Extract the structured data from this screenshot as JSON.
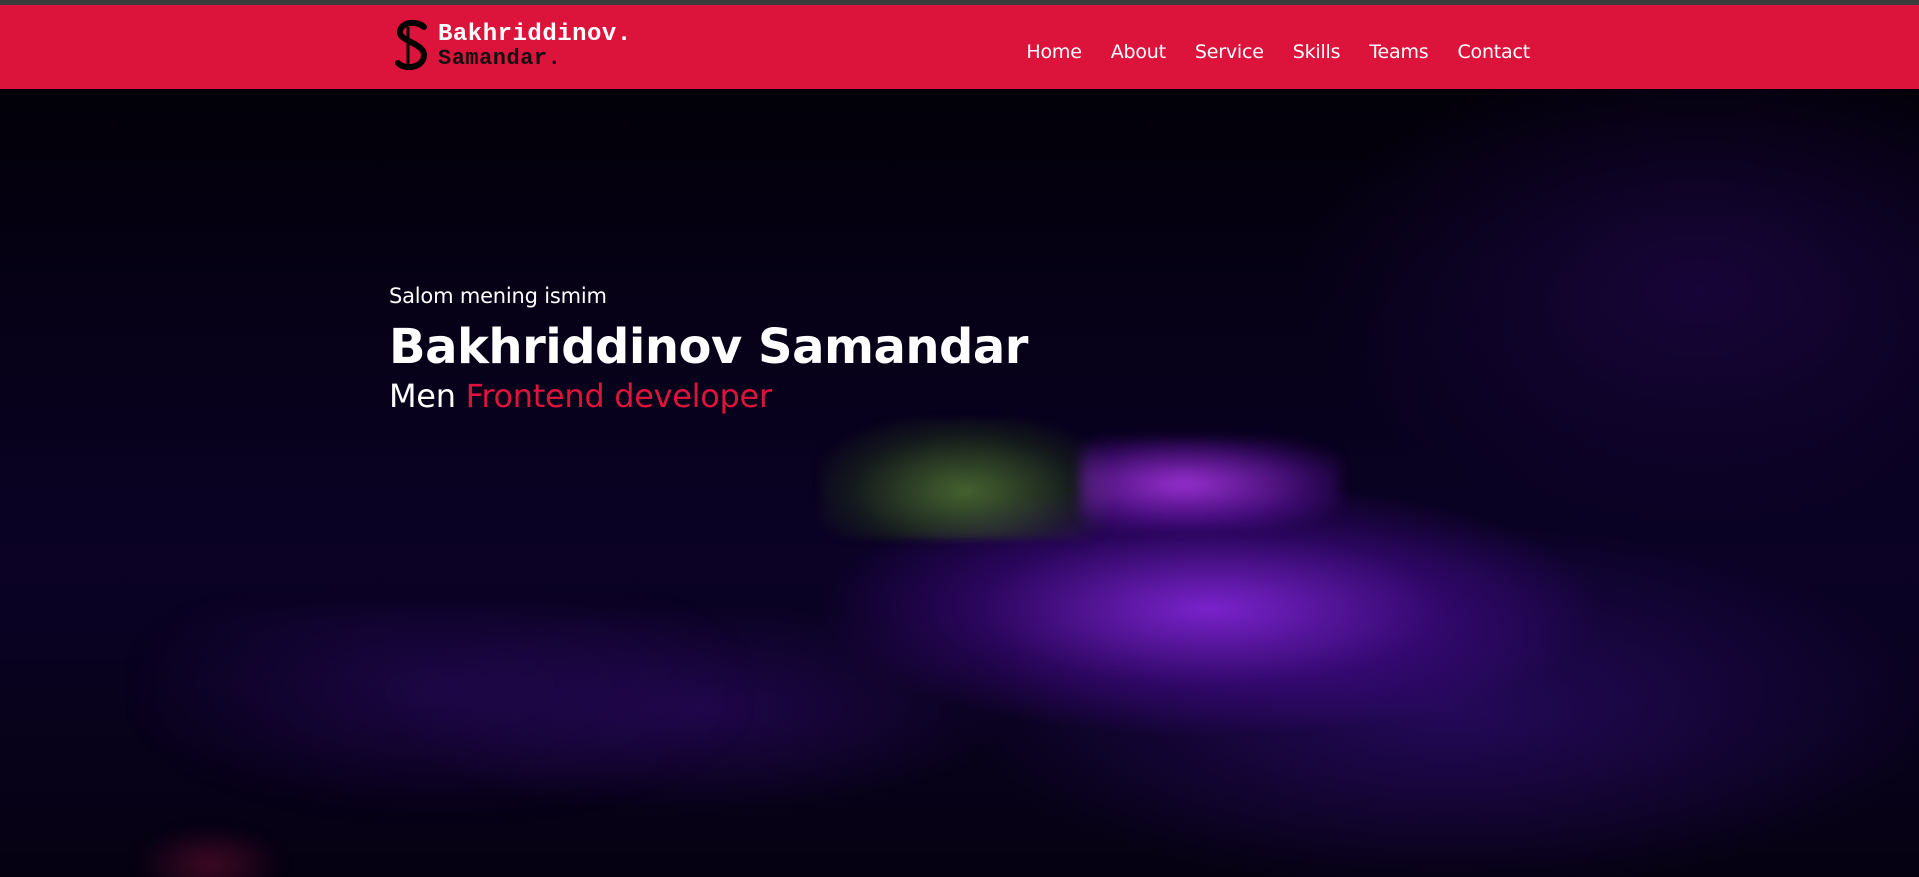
{
  "colors": {
    "navbar": "#dc143c",
    "accent": "#dc143c",
    "text": "#ffffff",
    "background": "#000000"
  },
  "logo": {
    "mark": "S",
    "line1": "Bakhriddinov.",
    "line2": "Samandar."
  },
  "nav": {
    "items": [
      "Home",
      "About",
      "Service",
      "Skills",
      "Teams",
      "Contact"
    ]
  },
  "hero": {
    "greeting": "Salom mening ismim",
    "name": "Bakhriddinov Samandar",
    "role_prefix": "Men",
    "role_highlight": "Frontend developer"
  }
}
